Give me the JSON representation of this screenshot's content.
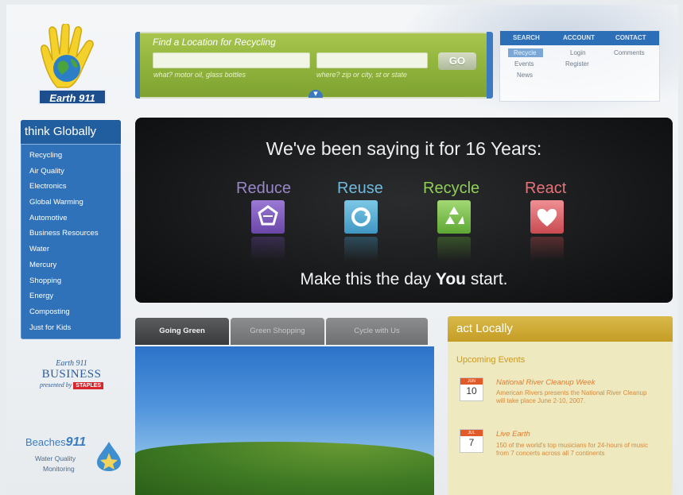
{
  "logo": {
    "text": "Earth 911"
  },
  "search": {
    "title": "Find a Location for Recycling",
    "what_placeholder": "what? motor oil, glass bottles",
    "where_placeholder": "where? zip or city, st or state",
    "go_label": "GO"
  },
  "topnav": {
    "headers": [
      "SEARCH",
      "ACCOUNT",
      "CONTACT"
    ],
    "search_items": [
      "Recycle",
      "Events",
      "News"
    ],
    "account_items": [
      "Login",
      "Register"
    ],
    "contact_items": [
      "Comments"
    ]
  },
  "sidebar": {
    "title": "think Globally",
    "items": [
      "Recycling",
      "Air Quality",
      "Electronics",
      "Global Warming",
      "Automotive",
      "Business Resources",
      "Water",
      "Mercury",
      "Shopping",
      "Energy",
      "Composting",
      "Just for Kids"
    ]
  },
  "hero": {
    "title": "We've been saying it for 16 Years:",
    "words": [
      "Reduce",
      "Reuse",
      "Recycle",
      "React"
    ],
    "bottom_prefix": "Make this the day ",
    "bottom_bold": "You",
    "bottom_suffix": " start."
  },
  "tabs": [
    "Going Green",
    "Green Shopping",
    "Cycle with Us"
  ],
  "act": {
    "title": "act Locally",
    "subtitle": "Upcoming Events",
    "events": [
      {
        "month": "JUN",
        "day": "10",
        "title": "National River Cleanup Week",
        "desc": "American Rivers presents the National River Cleanup will take place June 2-10, 2007."
      },
      {
        "month": "JUL",
        "day": "7",
        "title": "Live Earth",
        "desc": "150 of the world's top musicians for 24-hours of music from 7 concerts across all 7 continents"
      }
    ]
  },
  "promos": {
    "business_top": "Earth 911",
    "business_main": "BUSINESS",
    "business_by": "presented by",
    "business_brand": "STAPLES",
    "beaches_name": "Beaches",
    "beaches_num": "911",
    "beaches_line1": "Water Quality",
    "beaches_line2": "Monitoring"
  },
  "colors": {
    "brand_blue": "#2f72b9",
    "search_green": "#8eb23b",
    "act_gold": "#c49d25",
    "reduce": "#7b56b8",
    "reuse": "#4aa7cf",
    "recycle": "#7cc04a",
    "react": "#d8585e"
  }
}
